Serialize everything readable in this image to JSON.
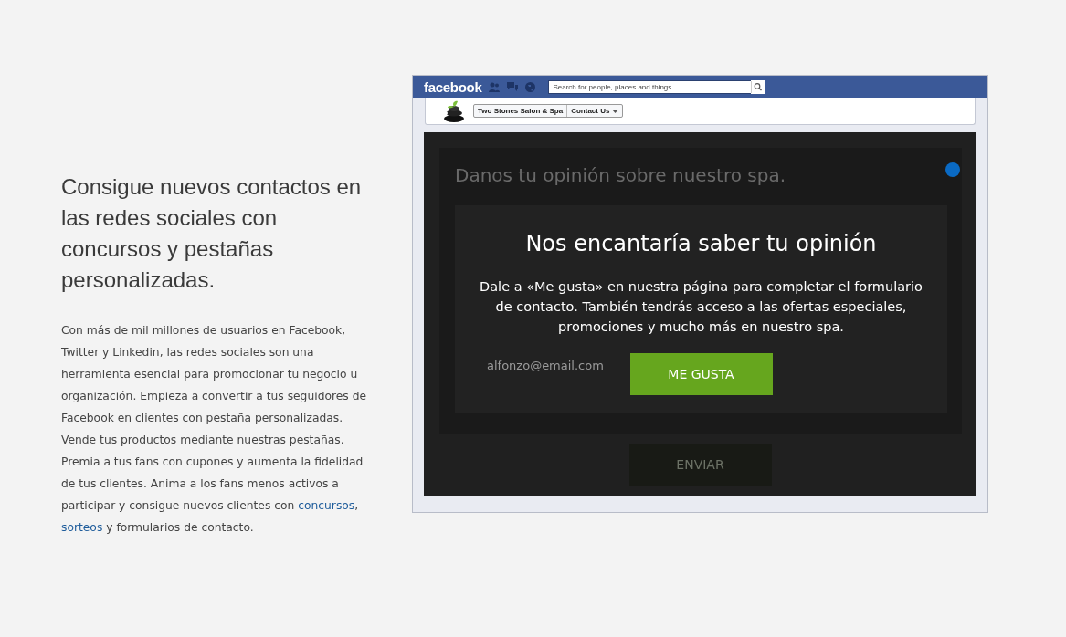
{
  "intro": {
    "heading": "Consigue nuevos contactos en las redes sociales con concursos y pestañas personalizadas.",
    "paragraph": [
      {
        "kind": "text",
        "text": "Con más de mil millones de usuarios en Facebook, Twitter y Linkedin, las redes sociales son una herramienta esencial para promocionar tu negocio u organización. Empieza a convertir a tus seguidores de Facebook en clientes con pestaña personalizadas. Vende tus productos mediante nuestras pestañas. Premia a tus fans con cupones y aumenta la fidelidad de tus clientes. Anima a los fans menos activos a participar y consigue nuevos clientes con "
      },
      {
        "kind": "link",
        "text": "concursos"
      },
      {
        "kind": "text",
        "text": ", "
      },
      {
        "kind": "link",
        "text": "sorteos"
      },
      {
        "kind": "text",
        "text": " y formularios de contacto."
      }
    ]
  },
  "facebook": {
    "logo": "facebook",
    "search": {
      "placeholder": "Search for people, places and things"
    },
    "page_name": "Two Stones Salon & Spa",
    "tab": "Contact Us"
  },
  "form": {
    "title": "Danos tu opinión sobre nuestro spa.",
    "email": "alfonzo@email.com",
    "submit": "ENVIAR"
  },
  "modal": {
    "title": "Nos encantaría saber tu opinión",
    "body": "Dale a «Me gusta» en nuestra página para completar el formulario de contacto. También tendrás acceso a las ofertas especiales, promociones y mucho más en nuestro spa.",
    "button": "ME GUSTA"
  }
}
